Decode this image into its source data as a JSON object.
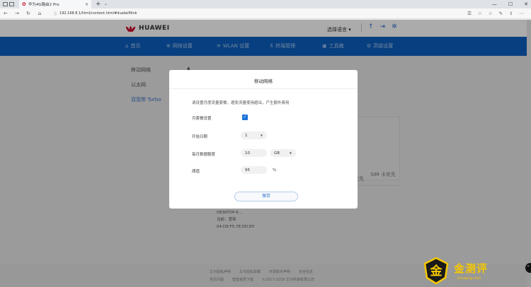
{
  "browser": {
    "tab_title": "华为4G路由2 Pro",
    "tab_close": "×",
    "new_tab": "+",
    "new_tab_dropdown": "⌄",
    "window_controls": [
      "—",
      "☐",
      "✕"
    ],
    "url": "192.168.8.1/html/content.html#dualwifilink",
    "nav_buttons": [
      "←",
      "→",
      "↻",
      "⌂"
    ],
    "addr_icons": [
      "☰",
      "☆",
      "☆",
      "✎",
      "⇪",
      "⋯"
    ]
  },
  "header": {
    "logo_text": "HUAWEI",
    "language": "选择语言 ▾"
  },
  "nav": {
    "items": [
      {
        "icon": "⌂",
        "label": "首页"
      },
      {
        "icon": "⊕",
        "label": "网络设置"
      },
      {
        "icon": "≋",
        "label": "WLAN 设置"
      },
      {
        "icon": "⊼",
        "label": "终端管理"
      },
      {
        "icon": "▣",
        "label": "工具箱"
      },
      {
        "icon": "⚙",
        "label": "高级设置"
      }
    ]
  },
  "sidebar": {
    "items": [
      {
        "label": "移动网络"
      },
      {
        "label": "以太网"
      },
      {
        "label": "双宽带 Turbo"
      }
    ],
    "caret": "▲"
  },
  "background_panel": {
    "col1": "优先",
    "col2": "SIM 卡优先",
    "device_name": "DESKTOP-6...",
    "device_status": "当前：宽带",
    "device_mac": "04:D9:F5:7E:DD:E0"
  },
  "modal": {
    "title": "移动网络",
    "description": "请设置月度流量套餐，避免流量使用超出，产生额外费用",
    "monthly_plan_label": "月套餐设置",
    "start_date_label": "开始日期",
    "start_date_value": "1",
    "data_limit_label": "每月数据额度",
    "data_limit_value": "10",
    "data_unit": "GB",
    "threshold_label": "阈值",
    "threshold_value": "95",
    "percent": "%",
    "save_label": "保存",
    "check": "✓",
    "caret": "▼"
  },
  "footer": {
    "row1": [
      "华为隐私声明",
      "华为隐私政策",
      "开源软件声明",
      "安全信息"
    ],
    "row2": [
      "常见问题",
      "智能家居下载",
      "©2017-2019 华为终端有限公司"
    ]
  },
  "watermark": {
    "text": "金测评",
    "url": "jincepng.com",
    "badge_char": "金"
  },
  "scroll_pill": "⌃",
  "colors": {
    "nav_blue": "#0c5fbf",
    "accent_blue": "#1a73d9",
    "huawei_red": "#cf0a2c",
    "watermark_gold": "#f5c800"
  }
}
